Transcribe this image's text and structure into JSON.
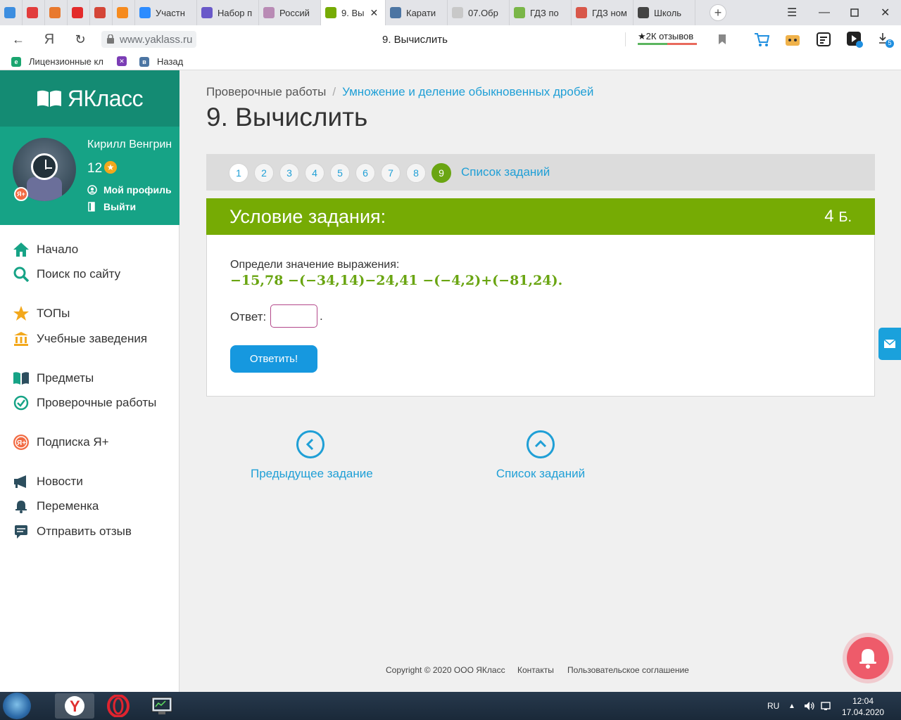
{
  "browser": {
    "tabs": [
      {
        "label": "",
        "color": "#3d8ee0"
      },
      {
        "label": "",
        "color": "#e23d3d"
      },
      {
        "label": "",
        "color": "#e8792e"
      },
      {
        "label": "",
        "color": "#e32b2b"
      },
      {
        "label": "",
        "color": "#d44638"
      },
      {
        "label": "",
        "color": "#f68b1f"
      },
      {
        "label": "Участн",
        "color": "#2d8cff"
      },
      {
        "label": "Набор п",
        "color": "#6a59c9"
      },
      {
        "label": "Россий",
        "color": "#b98bb5"
      },
      {
        "label": "9. Вы",
        "color": "#76ab04"
      },
      {
        "label": "Карати",
        "color": "#4c75a3"
      },
      {
        "label": "07.Обр",
        "color": "#c8c8c8"
      },
      {
        "label": "ГДЗ по",
        "color": "#7ab648"
      },
      {
        "label": "ГДЗ ном",
        "color": "#d8574a"
      },
      {
        "label": "Школь",
        "color": "#444444"
      }
    ],
    "url": "www.yaklass.ru",
    "page_title": "9. Вычислить",
    "reviews": "★2К отзывов",
    "downloads_count": "5",
    "bookmarks": [
      {
        "label": "Лицензионные кл",
        "color": "#1aa56f"
      },
      {
        "label": "",
        "color": "#7b3db5"
      },
      {
        "label": "Назад",
        "color": "#4c75a3"
      }
    ]
  },
  "sidebar": {
    "logo": "ЯКласс",
    "user_name": "Кирилл Венгрин",
    "points": "12",
    "profile_link": "Мой профиль",
    "logout_link": "Выйти",
    "menu": [
      {
        "label": "Начало",
        "icon": "home-icon"
      },
      {
        "label": "Поиск по сайту",
        "icon": "search-icon"
      },
      {
        "label": "ТОПы",
        "icon": "star-icon"
      },
      {
        "label": "Учебные заведения",
        "icon": "school-icon"
      },
      {
        "label": "Предметы",
        "icon": "book-icon"
      },
      {
        "label": "Проверочные работы",
        "icon": "check-circle-icon"
      },
      {
        "label": "Подписка Я+",
        "icon": "subscription-icon"
      },
      {
        "label": "Новости",
        "icon": "megaphone-icon"
      },
      {
        "label": "Переменка",
        "icon": "bell-icon"
      },
      {
        "label": "Отправить отзыв",
        "icon": "feedback-icon"
      }
    ]
  },
  "main": {
    "breadcrumb_root": "Проверочные работы",
    "breadcrumb_sep": "/",
    "breadcrumb_link": "Умножение и деление обыкновенных дробей",
    "title": "9. Вычислить",
    "pages": [
      "1",
      "2",
      "3",
      "4",
      "5",
      "6",
      "7",
      "8",
      "9"
    ],
    "current_page": "9",
    "task_list_link": "Список заданий",
    "task_header": "Условие задания:",
    "points_value": "4",
    "points_unit": "Б.",
    "question": "Определи значение выражения:",
    "expression": "−15,78 −(−34,14)−24,41 −(−4,2)+(−81,24).",
    "answer_label": "Ответ:",
    "answer_value": "",
    "answer_suffix": ".",
    "submit_label": "Ответить!",
    "prev_label": "Предыдущее задание",
    "list_label": "Список заданий"
  },
  "footer": {
    "copyright": "Copyright © 2020 ООО ЯКласс",
    "contacts": "Контакты",
    "agreement": "Пользовательское соглашение"
  },
  "taskbar": {
    "lang": "RU",
    "time": "12:04",
    "date": "17.04.2020"
  },
  "colors": {
    "accent_green": "#76ab04",
    "brand_teal": "#16a386",
    "link_blue": "#1f9fd6"
  }
}
